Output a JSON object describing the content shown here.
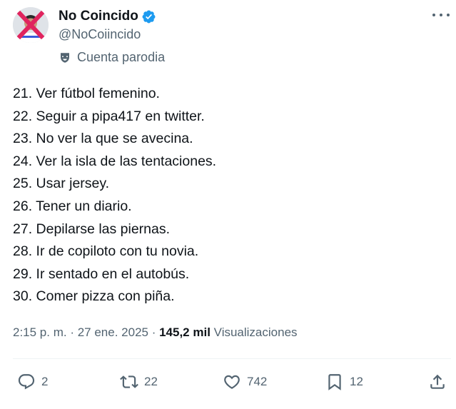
{
  "author": {
    "name": "No Coincido",
    "handle": "@NoCoiincido",
    "badge": "Cuenta parodia",
    "verified_color": "#1d9bf0"
  },
  "tweet": {
    "lines": [
      "21. Ver fútbol femenino.",
      "22. Seguir a pipa417 en twitter.",
      "23. No ver la que se avecina.",
      "24. Ver la isla de las tentaciones.",
      "25. Usar jersey.",
      "26. Tener un diario.",
      "27. Depilarse las piernas.",
      "28. Ir de copiloto con tu novia.",
      "29. Ir sentado en el autobús.",
      "30. Comer pizza con piña."
    ]
  },
  "meta": {
    "time": "2:15 p. m.",
    "separator": " · ",
    "date": "27 ene. 2025",
    "views_count": "145,2 mil",
    "views_label": "Visualizaciones"
  },
  "actions": {
    "replies": "2",
    "reposts": "22",
    "likes": "742",
    "bookmarks": "12"
  },
  "icons": [
    "more-icon",
    "verified-icon",
    "parody-mask-icon",
    "reply-icon",
    "repost-icon",
    "like-icon",
    "bookmark-icon",
    "share-icon"
  ]
}
